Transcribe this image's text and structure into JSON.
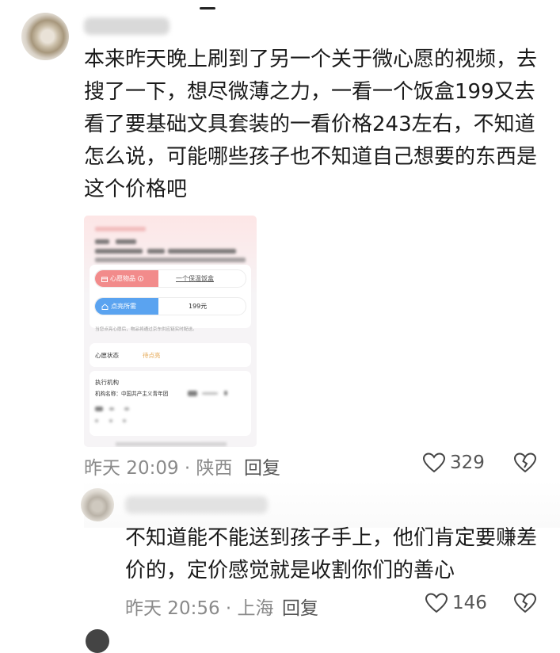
{
  "comment": {
    "text": "本来昨天晚上刷到了另一个关于微心愿的视频，去搜了一下，想尽微薄之力，一看一个饭盒199又去看了要基础文具套装的一看价格243左右，不知道怎么说，可能哪些孩子也不知道自己想要的东西是这个价格吧",
    "meta": "昨天 20:09 · 陕西",
    "reply_label": "回复",
    "like_count": "329",
    "screenshot": {
      "wish_item_label": "心愿物品",
      "wish_item_value": "一个保温饭盒",
      "light_need_label": "点亮所需",
      "light_need_value": "199元",
      "note": "当您点亮心愿后，物品将通过京东供应链实时配送。",
      "status_label": "心愿状态",
      "status_value": "待点亮",
      "org_title": "执行机构",
      "org_name_label": "机构名称：中国共产主义青年团"
    }
  },
  "reply": {
    "text": "不知道能不能送到孩子手上，他们肯定要赚差价的，定价感觉就是收割你们的善心",
    "meta": "昨天 20:56 · 上海",
    "reply_label": "回复",
    "like_count": "146"
  },
  "colors": {
    "meta_gray": "#8a8a8a",
    "tag_pink": "#f28b8b",
    "tag_blue": "#5aa3f0",
    "status_orange": "#e4a650"
  }
}
